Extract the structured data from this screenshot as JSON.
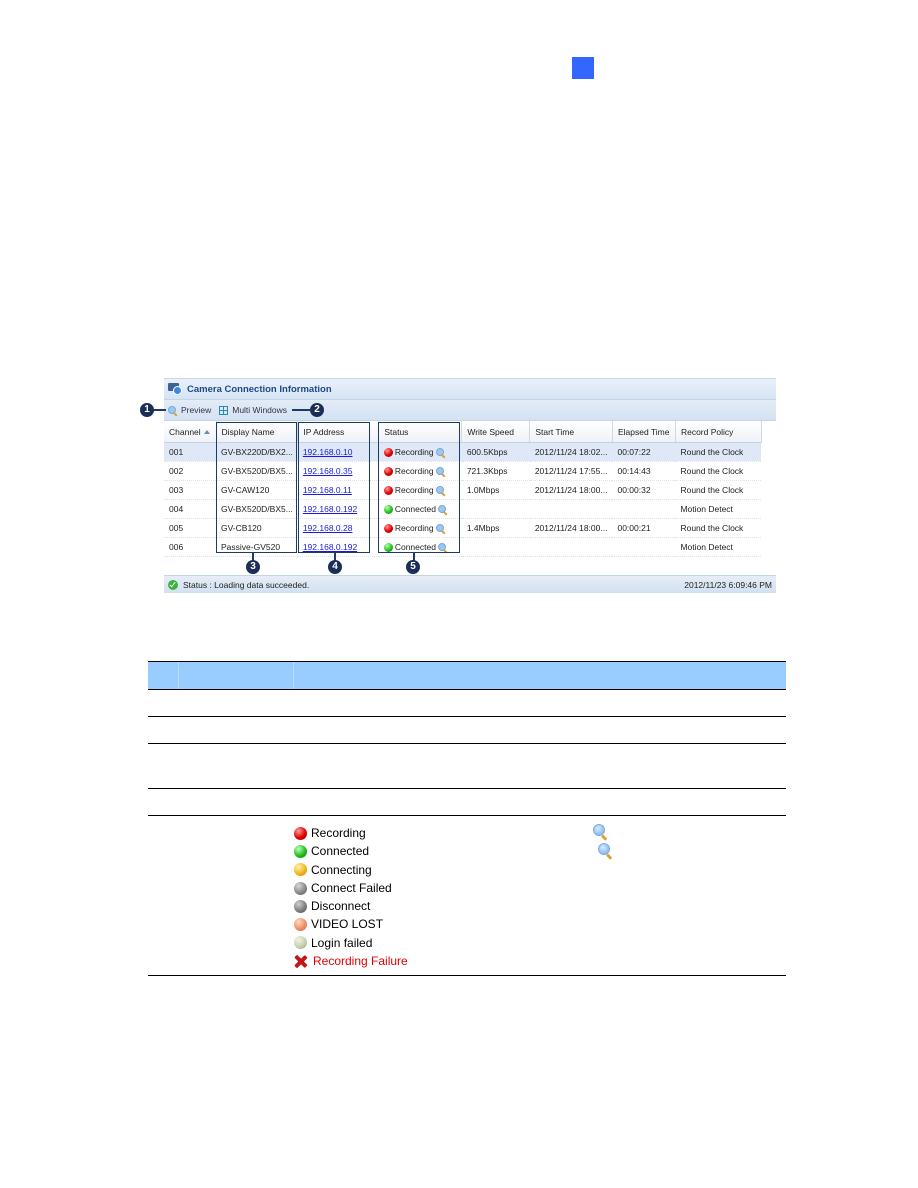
{
  "window": {
    "title": "Camera Connection Information",
    "toolbar": {
      "preview_label": "Preview",
      "multi_windows_label": "Multi Windows"
    },
    "columns": [
      "Channel",
      "Display Name",
      "IP Address",
      "Status",
      "Write Speed",
      "Start Time",
      "Elapsed Time",
      "Record Policy"
    ],
    "rows": [
      {
        "channel": "001",
        "display_name": "GV-BX220D/BX2...",
        "ip": "192.168.0.10",
        "status": "Recording",
        "status_color": "red",
        "write_speed": "600.5Kbps",
        "start_time": "2012/11/24 18:02...",
        "elapsed": "00:07:22",
        "policy": "Round the Clock",
        "selected": true
      },
      {
        "channel": "002",
        "display_name": "GV-BX520D/BX5...",
        "ip": "192.168.0.35",
        "status": "Recording",
        "status_color": "red",
        "write_speed": "721.3Kbps",
        "start_time": "2012/11/24 17:55...",
        "elapsed": "00:14:43",
        "policy": "Round the Clock",
        "selected": false
      },
      {
        "channel": "003",
        "display_name": "GV-CAW120",
        "ip": "192.168.0.11",
        "status": "Recording",
        "status_color": "red",
        "write_speed": "1.0Mbps",
        "start_time": "2012/11/24 18:00...",
        "elapsed": "00:00:32",
        "policy": "Round the Clock",
        "selected": false
      },
      {
        "channel": "004",
        "display_name": "GV-BX520D/BX5...",
        "ip": "192.168.0.192",
        "status": "Connected",
        "status_color": "green",
        "write_speed": "",
        "start_time": "",
        "elapsed": "",
        "policy": "Motion Detect",
        "selected": false
      },
      {
        "channel": "005",
        "display_name": "GV-CB120",
        "ip": "192.168.0.28",
        "status": "Recording",
        "status_color": "red",
        "write_speed": "1.4Mbps",
        "start_time": "2012/11/24 18:00...",
        "elapsed": "00:00:21",
        "policy": "Round the Clock",
        "selected": false
      },
      {
        "channel": "006",
        "display_name": "Passive-GV520",
        "ip": "192.168.0.192",
        "status": "Connected",
        "status_color": "green",
        "write_speed": "",
        "start_time": "",
        "elapsed": "",
        "policy": "Motion Detect",
        "selected": false
      }
    ],
    "statusbar": {
      "message": "Status : Loading data succeeded.",
      "timestamp": "2012/11/23 6:09:46 PM"
    }
  },
  "callouts": [
    "1",
    "2",
    "3",
    "4",
    "5"
  ],
  "legend": [
    {
      "label": "Recording",
      "icon": "red-ball-icon",
      "color": "#e00000"
    },
    {
      "label": "Connected",
      "icon": "green-ball-icon",
      "color": "#20c020"
    },
    {
      "label": "Connecting",
      "icon": "yellow-ball-icon",
      "color": "#f0b820"
    },
    {
      "label": "Connect Failed",
      "icon": "gray-ball-icon",
      "color": "#8a8a8a"
    },
    {
      "label": "Disconnect",
      "icon": "dark-gray-ball-icon",
      "color": "#808080"
    },
    {
      "label": "VIDEO LOST",
      "icon": "orange-ball-icon",
      "color": "#f0906a"
    },
    {
      "label": "Login failed",
      "icon": "pale-ball-icon",
      "color": "#c8d0b0"
    },
    {
      "label": "Recording Failure",
      "icon": "red-x-icon",
      "color": "#e00000"
    }
  ],
  "colors": {
    "chapter_marker": "#3366ff",
    "table_header": "#99ccff",
    "callout": "#1b2e55",
    "link": "#1a1ae0"
  }
}
